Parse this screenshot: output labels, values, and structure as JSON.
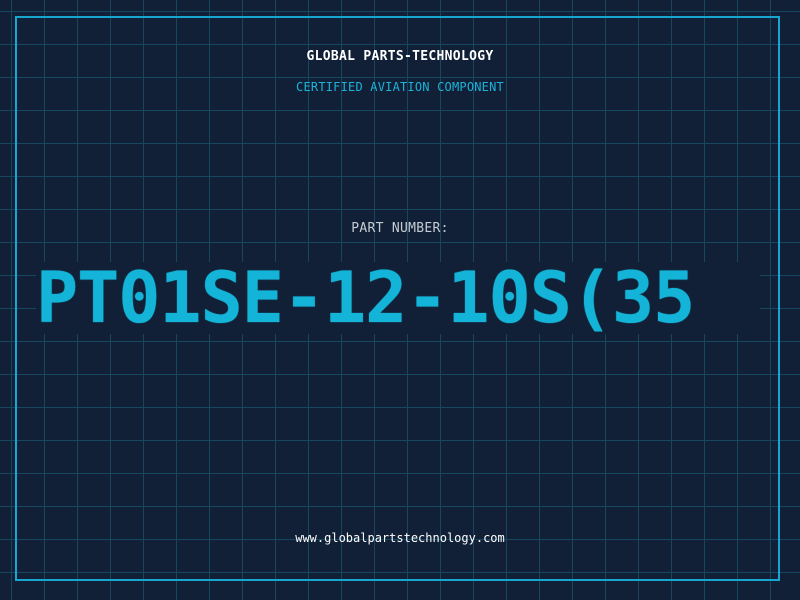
{
  "header": {
    "company": "GLOBAL PARTS-TECHNOLOGY",
    "tagline": "CERTIFIED AVIATION COMPONENT"
  },
  "part": {
    "label": "PART NUMBER:",
    "number": "PT01SE-12-10S(35"
  },
  "footer": {
    "website": "www.globalpartstechnology.com"
  },
  "colors": {
    "background": "#112036",
    "grid": "#16475f",
    "accent": "#14b4d8",
    "text": "#ffffff"
  }
}
